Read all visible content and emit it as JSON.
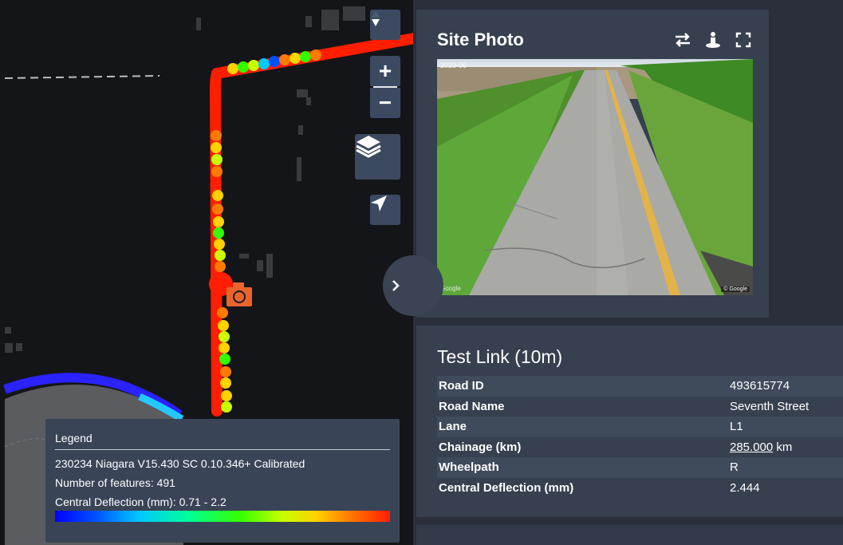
{
  "map": {
    "zoom_in_label": "+",
    "zoom_out_label": "−",
    "compass_icon": "north-arrow-icon",
    "layers_icon": "layers-icon",
    "locate_icon": "navigation-arrow-icon",
    "camera_icon": "camera-icon",
    "colors": {
      "route_high": "#ff1e00",
      "route_mid": "#ffd200",
      "route_low": "#00ff64",
      "route_min": "#0000ff",
      "camera_marker": "#e9642d"
    }
  },
  "panel": {
    "collapse_icon": "chevron-right-icon",
    "photo": {
      "title": "Site Photo",
      "date_overlay": "2023-06",
      "google_text": "Google",
      "watermark_text": "© Google",
      "tools": [
        "swap-icon",
        "pegman-icon",
        "fullscreen-icon"
      ]
    },
    "info": {
      "title": "Test Link (10m)",
      "rows": [
        {
          "label": "Road ID",
          "value": "493615774",
          "unit": ""
        },
        {
          "label": "Road Name",
          "value": "Seventh Street",
          "unit": ""
        },
        {
          "label": "Lane",
          "value": "L1",
          "unit": ""
        },
        {
          "label": "Chainage (km)",
          "value": "285.000",
          "unit": " km"
        },
        {
          "label": "Wheelpath",
          "value": "R",
          "unit": ""
        },
        {
          "label": "Central Deflection (mm)",
          "value": "2.444",
          "unit": ""
        }
      ]
    }
  },
  "legend": {
    "title": "Legend",
    "dataset": "230234 Niagara V15.430 SC 0.10.346+ Calibrated",
    "feature_count": "Number of features: 491",
    "range": "Central Deflection (mm): 0.71 - 2.2",
    "gradient_colors": [
      "#0000ff",
      "#00c8ff",
      "#32ff00",
      "#ffd200",
      "#ff1e00"
    ]
  }
}
